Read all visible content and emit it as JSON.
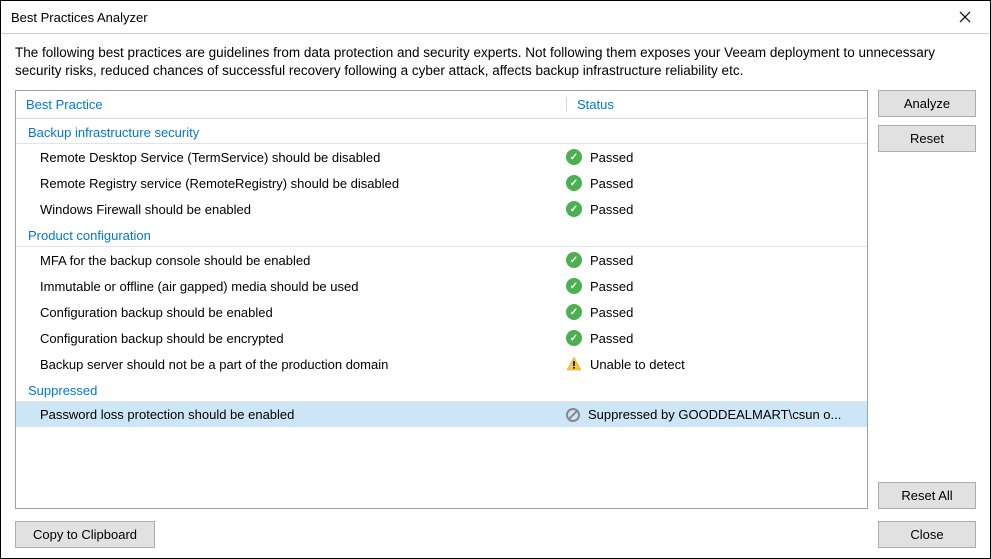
{
  "window": {
    "title": "Best Practices Analyzer"
  },
  "intro": "The following best practices are guidelines from data protection and security experts. Not following them exposes your Veeam deployment to unnecessary security risks, reduced chances of successful recovery following a cyber attack, affects backup infrastructure reliability etc.",
  "columns": {
    "best_practice": "Best Practice",
    "status": "Status"
  },
  "groups": [
    {
      "name": "Backup infrastructure security",
      "items": [
        {
          "label": "Remote Desktop Service (TermService) should be disabled",
          "status_icon": "pass",
          "status_text": "Passed"
        },
        {
          "label": "Remote Registry service (RemoteRegistry) should be disabled",
          "status_icon": "pass",
          "status_text": "Passed"
        },
        {
          "label": "Windows Firewall should be enabled",
          "status_icon": "pass",
          "status_text": "Passed"
        }
      ]
    },
    {
      "name": "Product configuration",
      "items": [
        {
          "label": "MFA for the backup console should be enabled",
          "status_icon": "pass",
          "status_text": "Passed"
        },
        {
          "label": "Immutable or offline (air gapped) media should be used",
          "status_icon": "pass",
          "status_text": "Passed"
        },
        {
          "label": "Configuration backup should be enabled",
          "status_icon": "pass",
          "status_text": "Passed"
        },
        {
          "label": "Configuration backup should be encrypted",
          "status_icon": "pass",
          "status_text": "Passed"
        },
        {
          "label": "Backup server should not be a part of the production domain",
          "status_icon": "warn",
          "status_text": "Unable to detect"
        }
      ]
    },
    {
      "name": "Suppressed",
      "items": [
        {
          "label": "Password loss protection should be enabled",
          "status_icon": "suppressed",
          "status_text": "Suppressed by GOODDEALMART\\csun o...",
          "selected": true
        }
      ]
    }
  ],
  "buttons": {
    "analyze": "Analyze",
    "reset": "Reset",
    "reset_all": "Reset All",
    "copy": "Copy to Clipboard",
    "close": "Close"
  }
}
